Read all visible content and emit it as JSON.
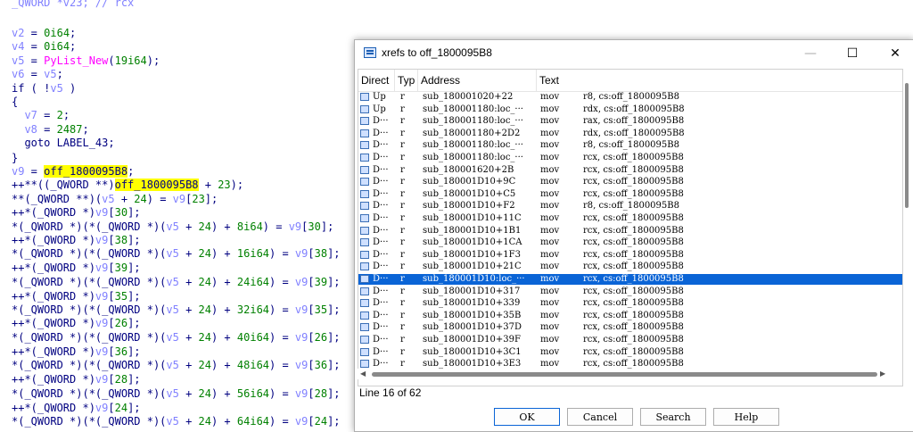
{
  "code": {
    "first_line": "_QWORD *v23; // rcx",
    "lines": [
      [
        [
          "var",
          "v2"
        ],
        [
          "plain",
          " = "
        ],
        [
          "num",
          "0i64"
        ],
        [
          "plain",
          ";"
        ]
      ],
      [
        [
          "var",
          "v4"
        ],
        [
          "plain",
          " = "
        ],
        [
          "num",
          "0i64"
        ],
        [
          "plain",
          ";"
        ]
      ],
      [
        [
          "var",
          "v5"
        ],
        [
          "plain",
          " = "
        ],
        [
          "fn",
          "PyList_New"
        ],
        [
          "plain",
          "("
        ],
        [
          "num",
          "19i64"
        ],
        [
          "plain",
          ");"
        ]
      ],
      [
        [
          "var",
          "v6"
        ],
        [
          "plain",
          " = "
        ],
        [
          "var",
          "v5"
        ],
        [
          "plain",
          ";"
        ]
      ],
      [
        [
          "plain",
          "if ( !"
        ],
        [
          "var",
          "v5"
        ],
        [
          "plain",
          " )"
        ]
      ],
      [
        [
          "plain",
          "{"
        ]
      ],
      [
        [
          "plain",
          "  "
        ],
        [
          "var",
          "v7"
        ],
        [
          "plain",
          " = "
        ],
        [
          "num",
          "2"
        ],
        [
          "plain",
          ";"
        ]
      ],
      [
        [
          "plain",
          "  "
        ],
        [
          "var",
          "v8"
        ],
        [
          "plain",
          " = "
        ],
        [
          "num",
          "2487"
        ],
        [
          "plain",
          ";"
        ]
      ],
      [
        [
          "plain",
          "  goto LABEL_43;"
        ]
      ],
      [
        [
          "plain",
          "}"
        ]
      ],
      [
        [
          "var",
          "v9"
        ],
        [
          "plain",
          " = "
        ],
        [
          "hl",
          "off_1800095B8"
        ],
        [
          "plain",
          ";"
        ]
      ],
      [
        [
          "plain",
          "++**((_QWORD **)"
        ],
        [
          "hl",
          "off_1800095B8"
        ],
        [
          "plain",
          " + "
        ],
        [
          "num",
          "23"
        ],
        [
          "plain",
          ");"
        ]
      ],
      [
        [
          "plain",
          "**(_QWORD **)("
        ],
        [
          "var",
          "v5"
        ],
        [
          "plain",
          " + "
        ],
        [
          "num",
          "24"
        ],
        [
          "plain",
          ") = "
        ],
        [
          "var",
          "v9"
        ],
        [
          "plain",
          "["
        ],
        [
          "num",
          "23"
        ],
        [
          "plain",
          "];"
        ]
      ],
      [
        [
          "plain",
          "++*(_QWORD *)"
        ],
        [
          "var",
          "v9"
        ],
        [
          "plain",
          "["
        ],
        [
          "num",
          "30"
        ],
        [
          "plain",
          "];"
        ]
      ],
      [
        [
          "plain",
          "*(_QWORD *)(*(_QWORD *)("
        ],
        [
          "var",
          "v5"
        ],
        [
          "plain",
          " + "
        ],
        [
          "num",
          "24"
        ],
        [
          "plain",
          ") + "
        ],
        [
          "num",
          "8i64"
        ],
        [
          "plain",
          ") = "
        ],
        [
          "var",
          "v9"
        ],
        [
          "plain",
          "["
        ],
        [
          "num",
          "30"
        ],
        [
          "plain",
          "];"
        ]
      ],
      [
        [
          "plain",
          "++*(_QWORD *)"
        ],
        [
          "var",
          "v9"
        ],
        [
          "plain",
          "["
        ],
        [
          "num",
          "38"
        ],
        [
          "plain",
          "];"
        ]
      ],
      [
        [
          "plain",
          "*(_QWORD *)(*(_QWORD *)("
        ],
        [
          "var",
          "v5"
        ],
        [
          "plain",
          " + "
        ],
        [
          "num",
          "24"
        ],
        [
          "plain",
          ") + "
        ],
        [
          "num",
          "16i64"
        ],
        [
          "plain",
          ") = "
        ],
        [
          "var",
          "v9"
        ],
        [
          "plain",
          "["
        ],
        [
          "num",
          "38"
        ],
        [
          "plain",
          "];"
        ]
      ],
      [
        [
          "plain",
          "++*(_QWORD *)"
        ],
        [
          "var",
          "v9"
        ],
        [
          "plain",
          "["
        ],
        [
          "num",
          "39"
        ],
        [
          "plain",
          "];"
        ]
      ],
      [
        [
          "plain",
          "*(_QWORD *)(*(_QWORD *)("
        ],
        [
          "var",
          "v5"
        ],
        [
          "plain",
          " + "
        ],
        [
          "num",
          "24"
        ],
        [
          "plain",
          ") + "
        ],
        [
          "num",
          "24i64"
        ],
        [
          "plain",
          ") = "
        ],
        [
          "var",
          "v9"
        ],
        [
          "plain",
          "["
        ],
        [
          "num",
          "39"
        ],
        [
          "plain",
          "];"
        ]
      ],
      [
        [
          "plain",
          "++*(_QWORD *)"
        ],
        [
          "var",
          "v9"
        ],
        [
          "plain",
          "["
        ],
        [
          "num",
          "35"
        ],
        [
          "plain",
          "];"
        ]
      ],
      [
        [
          "plain",
          "*(_QWORD *)(*(_QWORD *)("
        ],
        [
          "var",
          "v5"
        ],
        [
          "plain",
          " + "
        ],
        [
          "num",
          "24"
        ],
        [
          "plain",
          ") + "
        ],
        [
          "num",
          "32i64"
        ],
        [
          "plain",
          ") = "
        ],
        [
          "var",
          "v9"
        ],
        [
          "plain",
          "["
        ],
        [
          "num",
          "35"
        ],
        [
          "plain",
          "];"
        ]
      ],
      [
        [
          "plain",
          "++*(_QWORD *)"
        ],
        [
          "var",
          "v9"
        ],
        [
          "plain",
          "["
        ],
        [
          "num",
          "26"
        ],
        [
          "plain",
          "];"
        ]
      ],
      [
        [
          "plain",
          "*(_QWORD *)(*(_QWORD *)("
        ],
        [
          "var",
          "v5"
        ],
        [
          "plain",
          " + "
        ],
        [
          "num",
          "24"
        ],
        [
          "plain",
          ") + "
        ],
        [
          "num",
          "40i64"
        ],
        [
          "plain",
          ") = "
        ],
        [
          "var",
          "v9"
        ],
        [
          "plain",
          "["
        ],
        [
          "num",
          "26"
        ],
        [
          "plain",
          "];"
        ]
      ],
      [
        [
          "plain",
          "++*(_QWORD *)"
        ],
        [
          "var",
          "v9"
        ],
        [
          "plain",
          "["
        ],
        [
          "num",
          "36"
        ],
        [
          "plain",
          "];"
        ]
      ],
      [
        [
          "plain",
          "*(_QWORD *)(*(_QWORD *)("
        ],
        [
          "var",
          "v5"
        ],
        [
          "plain",
          " + "
        ],
        [
          "num",
          "24"
        ],
        [
          "plain",
          ") + "
        ],
        [
          "num",
          "48i64"
        ],
        [
          "plain",
          ") = "
        ],
        [
          "var",
          "v9"
        ],
        [
          "plain",
          "["
        ],
        [
          "num",
          "36"
        ],
        [
          "plain",
          "];"
        ]
      ],
      [
        [
          "plain",
          "++*(_QWORD *)"
        ],
        [
          "var",
          "v9"
        ],
        [
          "plain",
          "["
        ],
        [
          "num",
          "28"
        ],
        [
          "plain",
          "];"
        ]
      ],
      [
        [
          "plain",
          "*(_QWORD *)(*(_QWORD *)("
        ],
        [
          "var",
          "v5"
        ],
        [
          "plain",
          " + "
        ],
        [
          "num",
          "24"
        ],
        [
          "plain",
          ") + "
        ],
        [
          "num",
          "56i64"
        ],
        [
          "plain",
          ") = "
        ],
        [
          "var",
          "v9"
        ],
        [
          "plain",
          "["
        ],
        [
          "num",
          "28"
        ],
        [
          "plain",
          "];"
        ]
      ],
      [
        [
          "plain",
          "++*(_QWORD *)"
        ],
        [
          "var",
          "v9"
        ],
        [
          "plain",
          "["
        ],
        [
          "num",
          "24"
        ],
        [
          "plain",
          "];"
        ]
      ],
      [
        [
          "plain",
          "*(_QWORD *)(*(_QWORD *)("
        ],
        [
          "var",
          "v5"
        ],
        [
          "plain",
          " + "
        ],
        [
          "num",
          "24"
        ],
        [
          "plain",
          ") + "
        ],
        [
          "num",
          "64i64"
        ],
        [
          "plain",
          ") = "
        ],
        [
          "var",
          "v9"
        ],
        [
          "plain",
          "["
        ],
        [
          "num",
          "24"
        ],
        [
          "plain",
          "];"
        ]
      ]
    ],
    "line_tops": [
      30,
      45,
      61,
      76,
      92,
      107,
      122,
      138,
      153,
      170,
      185,
      200,
      216,
      231,
      247,
      262,
      277,
      293,
      309,
      325,
      340,
      355,
      371,
      387,
      402,
      418,
      434,
      450,
      465
    ]
  },
  "dialog": {
    "title": "xrefs to off_1800095B8",
    "columns": [
      "Direct",
      "Typ",
      "Address",
      "Text"
    ],
    "status": "Line 16 of 62",
    "buttons": {
      "ok": "OK",
      "cancel": "Cancel",
      "search": "Search",
      "help": "Help"
    },
    "selected_index": 15,
    "rows": [
      [
        "Up",
        "r",
        "sub_180001020+22",
        "mov",
        "r8, cs:off_1800095B8"
      ],
      [
        "Up",
        "r",
        "sub_180001180:loc_···",
        "mov",
        "rdx, cs:off_1800095B8"
      ],
      [
        "D···",
        "r",
        "sub_180001180:loc_···",
        "mov",
        "rax, cs:off_1800095B8"
      ],
      [
        "D···",
        "r",
        "sub_180001180+2D2",
        "mov",
        "rdx, cs:off_1800095B8"
      ],
      [
        "D···",
        "r",
        "sub_180001180:loc_···",
        "mov",
        "r8, cs:off_1800095B8"
      ],
      [
        "D···",
        "r",
        "sub_180001180:loc_···",
        "mov",
        "rcx, cs:off_1800095B8"
      ],
      [
        "D···",
        "r",
        "sub_180001620+2B",
        "mov",
        "rcx, cs:off_1800095B8"
      ],
      [
        "D···",
        "r",
        "sub_180001D10+9C",
        "mov",
        "rcx, cs:off_1800095B8"
      ],
      [
        "D···",
        "r",
        "sub_180001D10+C5",
        "mov",
        "rcx, cs:off_1800095B8"
      ],
      [
        "D···",
        "r",
        "sub_180001D10+F2",
        "mov",
        "r8, cs:off_1800095B8"
      ],
      [
        "D···",
        "r",
        "sub_180001D10+11C",
        "mov",
        "rcx, cs:off_1800095B8"
      ],
      [
        "D···",
        "r",
        "sub_180001D10+1B1",
        "mov",
        "rcx, cs:off_1800095B8"
      ],
      [
        "D···",
        "r",
        "sub_180001D10+1CA",
        "mov",
        "rcx, cs:off_1800095B8"
      ],
      [
        "D···",
        "r",
        "sub_180001D10+1F3",
        "mov",
        "rcx, cs:off_1800095B8"
      ],
      [
        "D···",
        "r",
        "sub_180001D10+21C",
        "mov",
        "rcx, cs:off_1800095B8"
      ],
      [
        "D···",
        "r",
        "sub_180001D10:loc_···",
        "mov",
        "rcx, cs:off_1800095B8"
      ],
      [
        "D···",
        "r",
        "sub_180001D10+317",
        "mov",
        "rcx, cs:off_1800095B8"
      ],
      [
        "D···",
        "r",
        "sub_180001D10+339",
        "mov",
        "rcx, cs:off_1800095B8"
      ],
      [
        "D···",
        "r",
        "sub_180001D10+35B",
        "mov",
        "rcx, cs:off_1800095B8"
      ],
      [
        "D···",
        "r",
        "sub_180001D10+37D",
        "mov",
        "rcx, cs:off_1800095B8"
      ],
      [
        "D···",
        "r",
        "sub_180001D10+39F",
        "mov",
        "rcx, cs:off_1800095B8"
      ],
      [
        "D···",
        "r",
        "sub_180001D10+3C1",
        "mov",
        "rcx, cs:off_1800095B8"
      ],
      [
        "D···",
        "r",
        "sub_180001D10+3E3",
        "mov",
        "rcx, cs:off_1800095B8"
      ]
    ]
  }
}
